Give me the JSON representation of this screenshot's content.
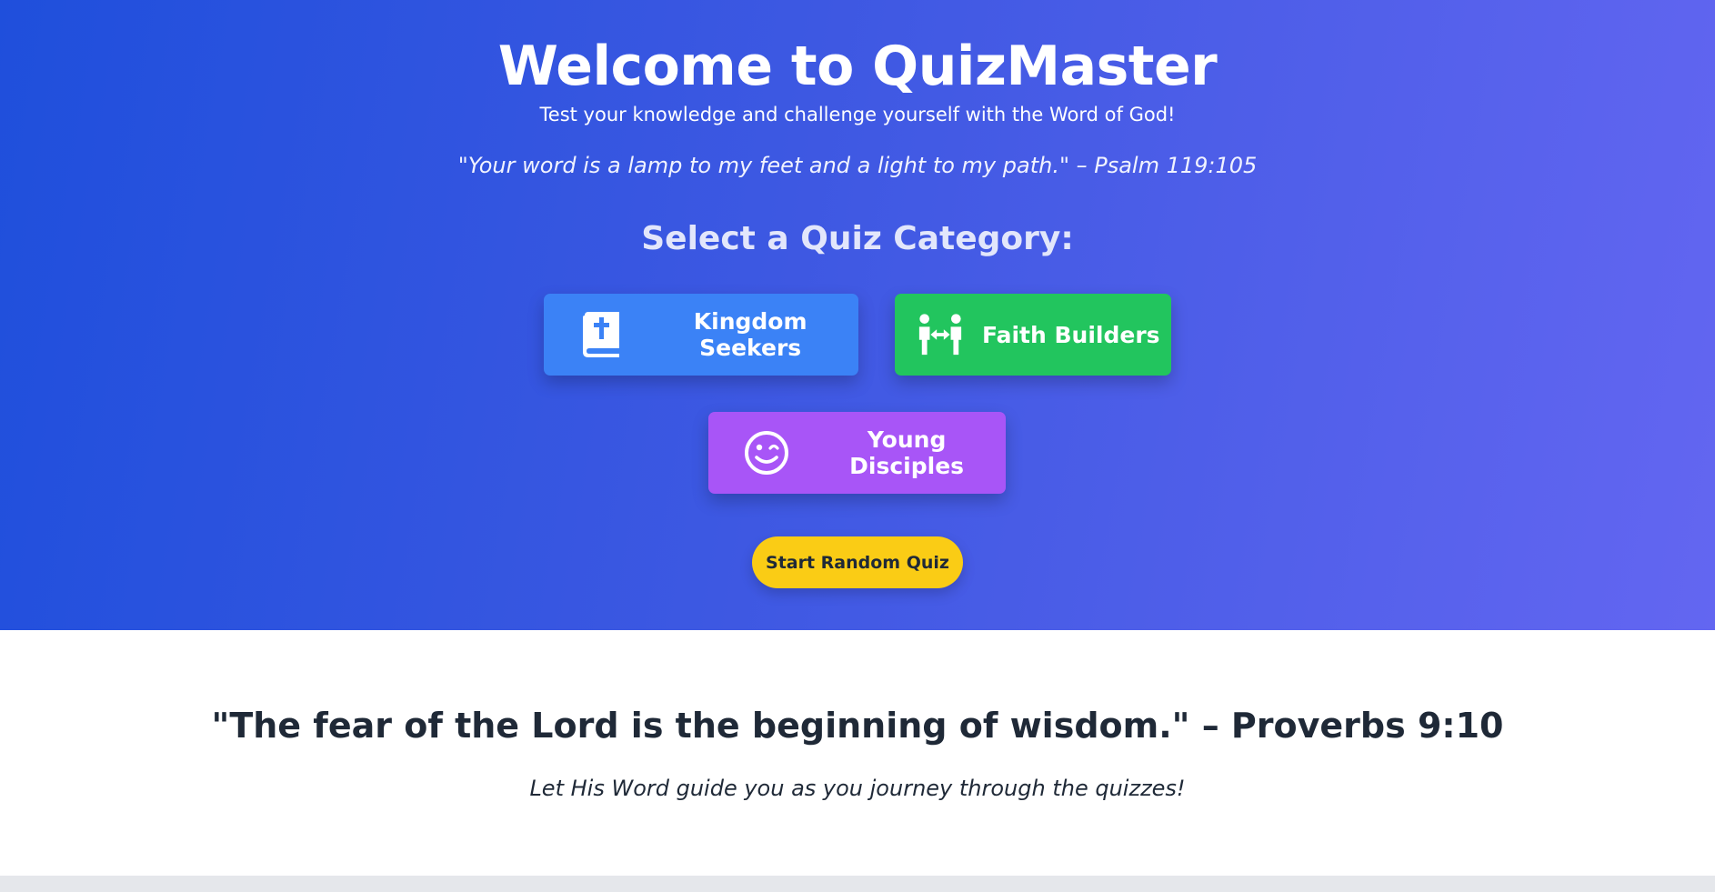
{
  "hero": {
    "title": "Welcome to QuizMaster",
    "subtitle": "Test your knowledge and challenge yourself with the Word of God!",
    "verse": "\"Your word is a lamp to my feet and a light to my path.\" – Psalm 119:105",
    "category_heading": "Select a Quiz Category:"
  },
  "categories": [
    {
      "label": "Kingdom Seekers",
      "icon": "bible-icon",
      "color": "#3b82f6"
    },
    {
      "label": "Faith Builders",
      "icon": "people-exchange-icon",
      "color": "#22c55e"
    },
    {
      "label": "Young Disciples",
      "icon": "wink-face-icon",
      "color": "#a855f7"
    }
  ],
  "random_button": {
    "label": "Start Random Quiz",
    "color": "#facc15"
  },
  "footer": {
    "verse": "\"The fear of the Lord is the beginning of wisdom.\" – Proverbs 9:10",
    "note": "Let His Word guide you as you journey through the quizzes!"
  },
  "colors": {
    "gradient_start": "#1f4fdc",
    "gradient_end": "#6366f1"
  }
}
